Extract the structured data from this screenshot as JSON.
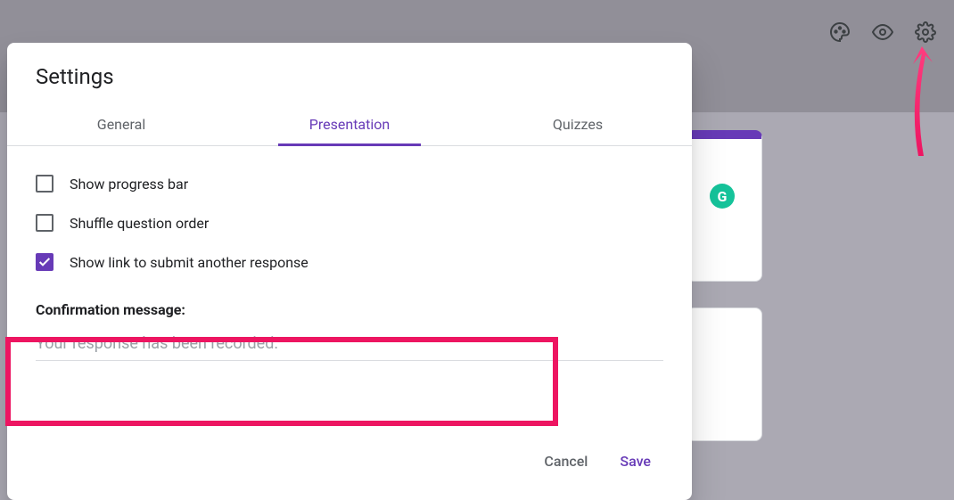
{
  "toolbar": {
    "icons": [
      "palette-icon",
      "eye-icon",
      "gear-icon"
    ]
  },
  "dialog": {
    "title": "Settings",
    "tabs": [
      {
        "label": "General",
        "active": false
      },
      {
        "label": "Presentation",
        "active": true
      },
      {
        "label": "Quizzes",
        "active": false
      }
    ],
    "options": [
      {
        "label": "Show progress bar",
        "checked": false
      },
      {
        "label": "Shuffle question order",
        "checked": false
      },
      {
        "label": "Show link to submit another response",
        "checked": true
      }
    ],
    "confirmation": {
      "label": "Confirmation message:",
      "placeholder": "Your response has been recorded.",
      "value": ""
    },
    "actions": {
      "cancel": "Cancel",
      "save": "Save"
    }
  },
  "badge": {
    "letter": "G"
  },
  "colors": {
    "accent": "#673ab7",
    "highlight": "#ed1561",
    "badge": "#15c39a"
  }
}
